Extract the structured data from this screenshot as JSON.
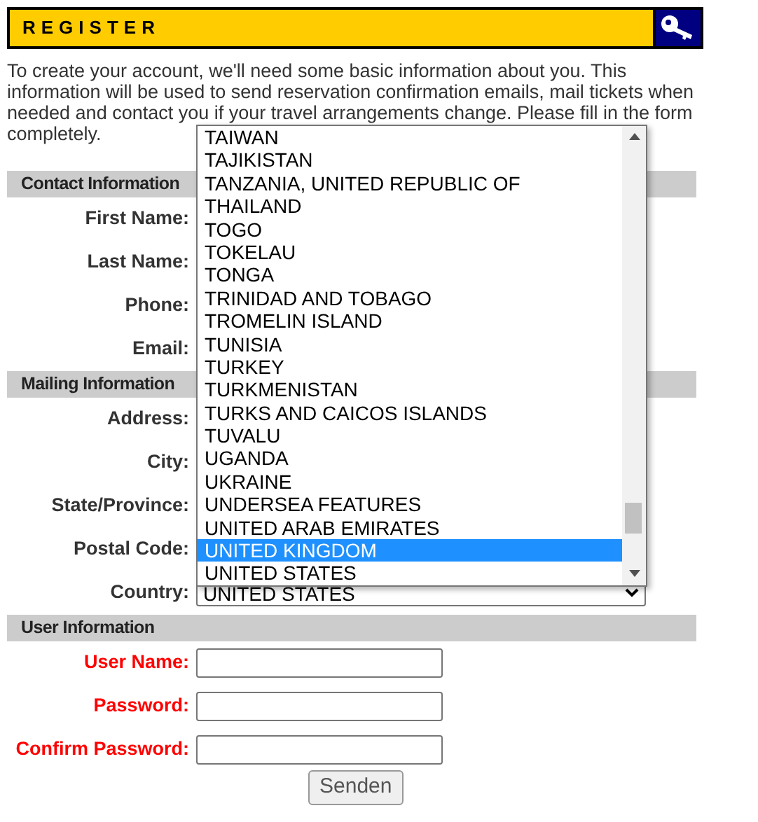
{
  "header": {
    "title": "REGISTER"
  },
  "intro": [
    "To create your account, we'll need some basic information about you. This information will be used to send reservation confirmation emails, mail tickets when needed and contact you if your travel arrangements change. Please fill in the form",
    "completely."
  ],
  "sections": [
    {
      "title": "Contact Information",
      "fields": [
        {
          "label": "First Name:",
          "kind": "hidden",
          "required": false
        },
        {
          "label": "Last Name:",
          "kind": "hidden",
          "required": false
        },
        {
          "label": "Phone:",
          "kind": "hidden",
          "required": false
        },
        {
          "label": "Email:",
          "kind": "hidden",
          "required": false
        }
      ]
    },
    {
      "title": "Mailing Information",
      "fields": [
        {
          "label": "Address:",
          "kind": "hidden",
          "required": false
        },
        {
          "label": "City:",
          "kind": "hidden",
          "required": false
        },
        {
          "label": "State/Province:",
          "kind": "hidden",
          "required": false
        },
        {
          "label": "Postal Code:",
          "kind": "hidden",
          "required": false
        },
        {
          "label": "Country:",
          "kind": "select",
          "required": false,
          "value": "UNITED STATES"
        }
      ]
    },
    {
      "title": "User Information",
      "fields": [
        {
          "label": "User Name:",
          "kind": "text",
          "required": true
        },
        {
          "label": "Password:",
          "kind": "text",
          "required": true
        },
        {
          "label": "Confirm Password:",
          "kind": "text",
          "required": true
        }
      ]
    }
  ],
  "country_list": [
    {
      "label": "TAIWAN",
      "selected": false
    },
    {
      "label": "TAJIKISTAN",
      "selected": false
    },
    {
      "label": "TANZANIA, UNITED REPUBLIC OF",
      "selected": false
    },
    {
      "label": "THAILAND",
      "selected": false
    },
    {
      "label": "TOGO",
      "selected": false
    },
    {
      "label": "TOKELAU",
      "selected": false
    },
    {
      "label": "TONGA",
      "selected": false
    },
    {
      "label": "TRINIDAD AND TOBAGO",
      "selected": false
    },
    {
      "label": "TROMELIN ISLAND",
      "selected": false
    },
    {
      "label": "TUNISIA",
      "selected": false
    },
    {
      "label": "TURKEY",
      "selected": false
    },
    {
      "label": "TURKMENISTAN",
      "selected": false
    },
    {
      "label": "TURKS AND CAICOS ISLANDS",
      "selected": false
    },
    {
      "label": "TUVALU",
      "selected": false
    },
    {
      "label": "UGANDA",
      "selected": false
    },
    {
      "label": "UKRAINE",
      "selected": false
    },
    {
      "label": "UNDERSEA FEATURES",
      "selected": false
    },
    {
      "label": "UNITED ARAB EMIRATES",
      "selected": false
    },
    {
      "label": "UNITED KINGDOM",
      "selected": true
    },
    {
      "label": "UNITED STATES",
      "selected": false
    }
  ],
  "submit": "Senden"
}
